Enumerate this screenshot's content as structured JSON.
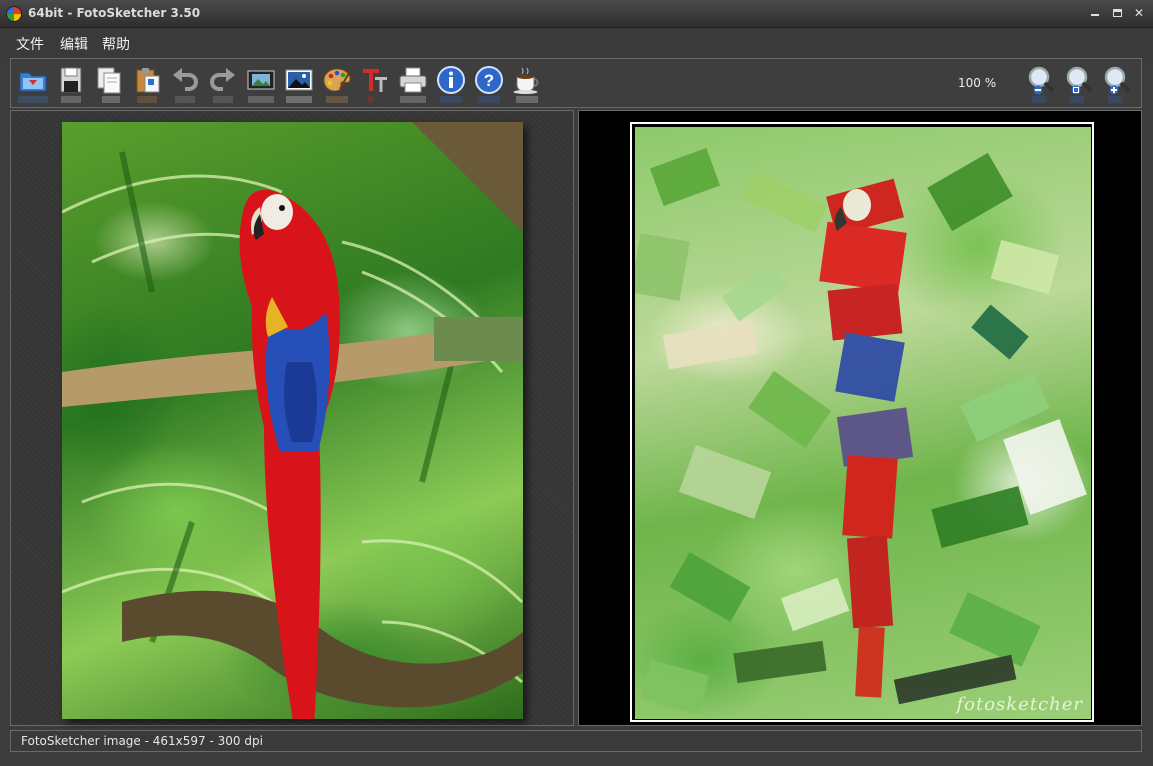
{
  "window": {
    "title": "64bit - FotoSketcher 3.50"
  },
  "menu": {
    "file": "文件",
    "edit": "编辑",
    "help": "帮助"
  },
  "toolbar": {
    "buttons": [
      {
        "name": "open-image",
        "icon": "folder-icon"
      },
      {
        "name": "save",
        "icon": "floppy-disk-icon"
      },
      {
        "name": "copy",
        "icon": "copy-icon"
      },
      {
        "name": "paste",
        "icon": "clipboard-icon"
      },
      {
        "name": "undo",
        "icon": "undo-arrow-icon"
      },
      {
        "name": "redo",
        "icon": "redo-arrow-icon"
      },
      {
        "name": "batch-process",
        "icon": "film-strip-icon"
      },
      {
        "name": "image-parameters",
        "icon": "landscape-picture-icon"
      },
      {
        "name": "drawing-parameters",
        "icon": "paint-palette-icon"
      },
      {
        "name": "add-text",
        "icon": "text-t-icon"
      },
      {
        "name": "print",
        "icon": "printer-icon"
      },
      {
        "name": "about",
        "icon": "info-icon"
      },
      {
        "name": "help",
        "icon": "question-mark-icon"
      },
      {
        "name": "donate",
        "icon": "coffee-cup-icon"
      },
      {
        "name": "zoom-out",
        "icon": "zoom-out-icon"
      },
      {
        "name": "zoom-actual",
        "icon": "zoom-fit-icon"
      },
      {
        "name": "zoom-in",
        "icon": "zoom-in-icon"
      }
    ],
    "zoom_level": "100 %"
  },
  "panels": {
    "original_description": "original photo: scarlet macaw on branch",
    "sketch_description": "painted version: scarlet macaw",
    "watermark": "fotosketcher"
  },
  "status": {
    "text": "FotoSketcher image - 461x597 - 300 dpi"
  },
  "colors": {
    "background": "#3c3c3c",
    "border": "#6a6a6a",
    "sketch_bg": "#000000"
  }
}
